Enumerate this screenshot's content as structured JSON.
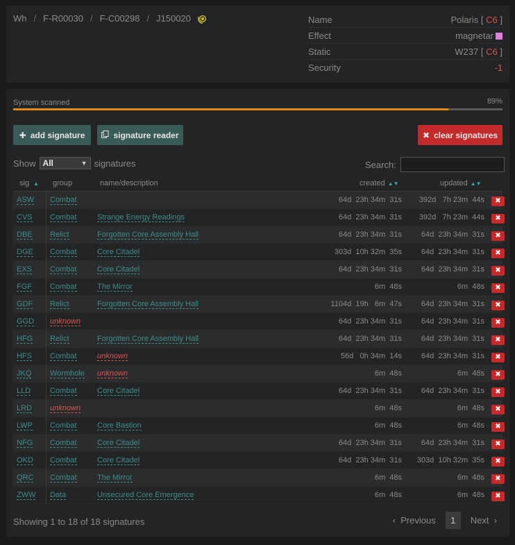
{
  "breadcrumb": {
    "items": [
      "Wh",
      "F-R00030",
      "F-C00298",
      "J150020"
    ],
    "separator": "/"
  },
  "system_info": {
    "name_label": "Name",
    "name_value": "Polaris",
    "name_class": "C6",
    "effect_label": "Effect",
    "effect_value": "magnetar",
    "effect_color": "#e27ee0",
    "static_label": "Static",
    "static_value": "W237",
    "static_class": "C6",
    "security_label": "Security",
    "security_value": "-1"
  },
  "scan": {
    "label": "System scanned",
    "percent_text": "89%",
    "percent": 89
  },
  "buttons": {
    "add": "add signature",
    "reader": "signature reader",
    "clear": "clear signatures"
  },
  "filter": {
    "show_label": "Show",
    "show_value": "All",
    "signatures_label": "signatures",
    "search_label": "Search:",
    "search_value": ""
  },
  "table": {
    "headers": {
      "sig": "sig",
      "group": "group",
      "name": "name/description",
      "created": "created",
      "updated": "updated"
    },
    "rows": [
      {
        "sig": "ASW",
        "group": "Combat",
        "name": "",
        "created": "64d  23h 34m  31s",
        "updated": "392d   7h 23m  44s"
      },
      {
        "sig": "CVS",
        "group": "Combat",
        "name": "Strange Energy Readings",
        "created": "64d  23h 34m  31s",
        "updated": "392d   7h 23m  44s"
      },
      {
        "sig": "DBE",
        "group": "Relict",
        "name": "Forgotten Core Assembly Hall",
        "created": "64d  23h 34m  31s",
        "updated": "64d  23h 34m  31s"
      },
      {
        "sig": "DGE",
        "group": "Combat",
        "name": "Core Citadel",
        "created": "303d  10h 32m  35s",
        "updated": "64d  23h 34m  31s"
      },
      {
        "sig": "EXS",
        "group": "Combat",
        "name": "Core Citadel",
        "created": "64d  23h 34m  31s",
        "updated": "64d  23h 34m  31s"
      },
      {
        "sig": "FGF",
        "group": "Combat",
        "name": "The Mirror",
        "created": "6m  48s",
        "updated": "6m  48s"
      },
      {
        "sig": "GDF",
        "group": "Relict",
        "name": "Forgotten Core Assembly Hall",
        "created": "1104d  19h   6m  47s",
        "updated": "64d  23h 34m  31s"
      },
      {
        "sig": "GGD",
        "group": "unknown",
        "name": "",
        "created": "64d  23h 34m  31s",
        "updated": "64d  23h 34m  31s"
      },
      {
        "sig": "HFG",
        "group": "Relict",
        "name": "Forgotten Core Assembly Hall",
        "created": "64d  23h 34m  31s",
        "updated": "64d  23h 34m  31s"
      },
      {
        "sig": "HFS",
        "group": "Combat",
        "name": "unknown",
        "created": "56d   0h 34m  14s",
        "updated": "64d  23h 34m  31s"
      },
      {
        "sig": "JKQ",
        "group": "Wormhole",
        "name": "unknown",
        "created": "6m  48s",
        "updated": "6m  48s"
      },
      {
        "sig": "LLD",
        "group": "Combat",
        "name": "Core Citadel",
        "created": "64d  23h 34m  31s",
        "updated": "64d  23h 34m  31s"
      },
      {
        "sig": "LRD",
        "group": "unknown",
        "name": "",
        "created": "6m  48s",
        "updated": "6m  48s"
      },
      {
        "sig": "LWP",
        "group": "Combat",
        "name": "Core Bastion",
        "created": "6m  48s",
        "updated": "6m  48s"
      },
      {
        "sig": "NFG",
        "group": "Combat",
        "name": "Core Citadel",
        "created": "64d  23h 34m  31s",
        "updated": "64d  23h 34m  31s"
      },
      {
        "sig": "OKD",
        "group": "Combat",
        "name": "Core Citadel",
        "created": "64d  23h 34m  31s",
        "updated": "303d  10h 32m  35s"
      },
      {
        "sig": "QRC",
        "group": "Combat",
        "name": "The Mirror",
        "created": "6m  48s",
        "updated": "6m  48s"
      },
      {
        "sig": "ZWW",
        "group": "Data",
        "name": "Unsecured Core Emergence",
        "created": "6m  48s",
        "updated": "6m  48s"
      }
    ]
  },
  "footer": {
    "info": "Showing 1 to 18 of 18 signatures",
    "previous": "Previous",
    "page": "1",
    "next": "Next"
  }
}
